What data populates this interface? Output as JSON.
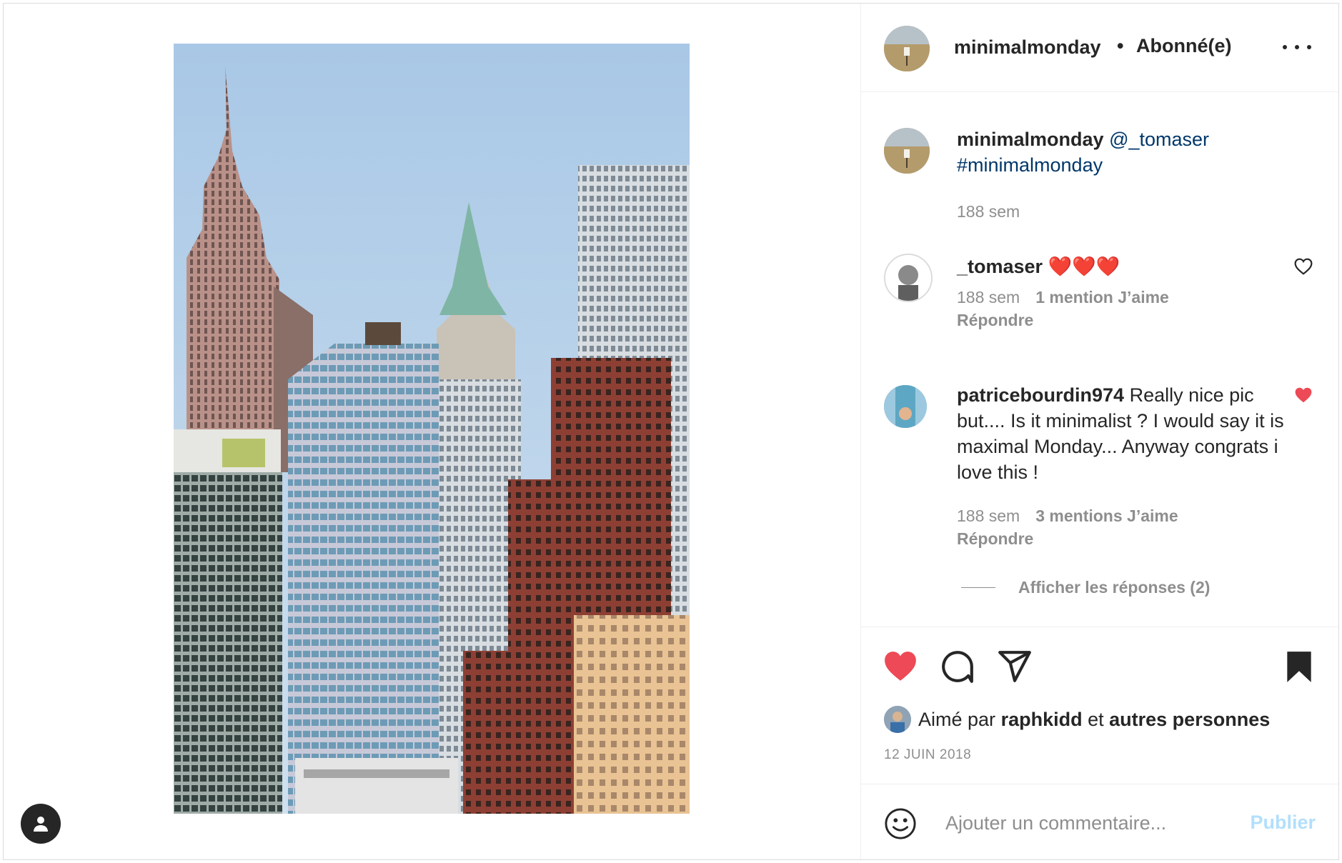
{
  "post": {
    "username": "minimalmonday",
    "dot": "•",
    "follow_status": "Abonné(e)",
    "date": "12 JUIN 2018"
  },
  "caption": {
    "username": "minimalmonday",
    "mention": "@_tomaser",
    "hashtag": "#minimalmonday",
    "time": "188 sem"
  },
  "comments": [
    {
      "username": "_tomaser",
      "text": "❤️❤️❤️",
      "time": "188 sem",
      "likes": "1 mention J’aime",
      "reply": "Répondre",
      "liked": false
    },
    {
      "username": "patricebourdin974",
      "text": "Really nice pic but.... Is it minimalist ? I would say it is maximal Monday... Anyway congrats i love this !",
      "time": "188 sem",
      "likes": "3 mentions J’aime",
      "reply": "Répondre",
      "liked": true
    }
  ],
  "view_replies": "Afficher les réponses (2)",
  "likes_line": {
    "prefix": "Aimé par",
    "user": "raphkidd",
    "connector": "et",
    "others": "autres personnes"
  },
  "add_comment": {
    "placeholder": "Ajouter un commentaire...",
    "publish": "Publier"
  },
  "colors": {
    "like_red": "#ed4956",
    "link_blue": "#00376b",
    "publish_disabled": "#b2dffc",
    "secondary_text": "#8e8e8e"
  },
  "icons": [
    "user-tag-icon",
    "more-options-icon",
    "heart-outline-icon",
    "heart-filled-icon",
    "comment-icon",
    "share-icon",
    "bookmark-filled-icon",
    "emoji-icon"
  ]
}
